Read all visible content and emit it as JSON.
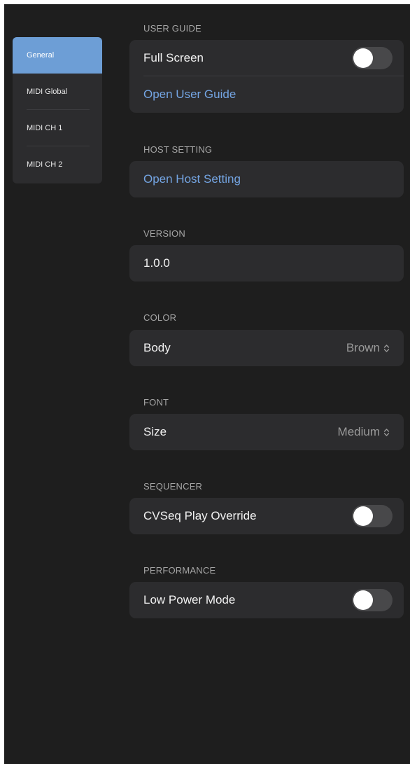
{
  "sidebar": {
    "items": [
      {
        "label": "General",
        "active": true
      },
      {
        "label": "MIDI Global",
        "active": false
      },
      {
        "label": "MIDI CH 1",
        "active": false
      },
      {
        "label": "MIDI CH 2",
        "active": false
      }
    ]
  },
  "user_guide": {
    "header": "USER GUIDE",
    "full_screen_label": "Full Screen",
    "full_screen_on": false,
    "open_link": "Open User Guide"
  },
  "host_setting": {
    "header": "HOST SETTING",
    "open_link": "Open Host Setting"
  },
  "version": {
    "header": "VERSION",
    "value": "1.0.0"
  },
  "color": {
    "header": "COLOR",
    "body_label": "Body",
    "body_value": "Brown"
  },
  "font": {
    "header": "FONT",
    "size_label": "Size",
    "size_value": "Medium"
  },
  "sequencer": {
    "header": "SEQUENCER",
    "override_label": "CVSeq Play Override",
    "override_on": false
  },
  "performance": {
    "header": "PERFORMANCE",
    "low_power_label": "Low Power Mode",
    "low_power_on": false
  },
  "colors": {
    "accent": "#6d9ed6",
    "link": "#74a5e3",
    "panel_bg": "#1e1e1e",
    "group_bg": "#2c2c2e",
    "toggle_off": "#48484a"
  }
}
